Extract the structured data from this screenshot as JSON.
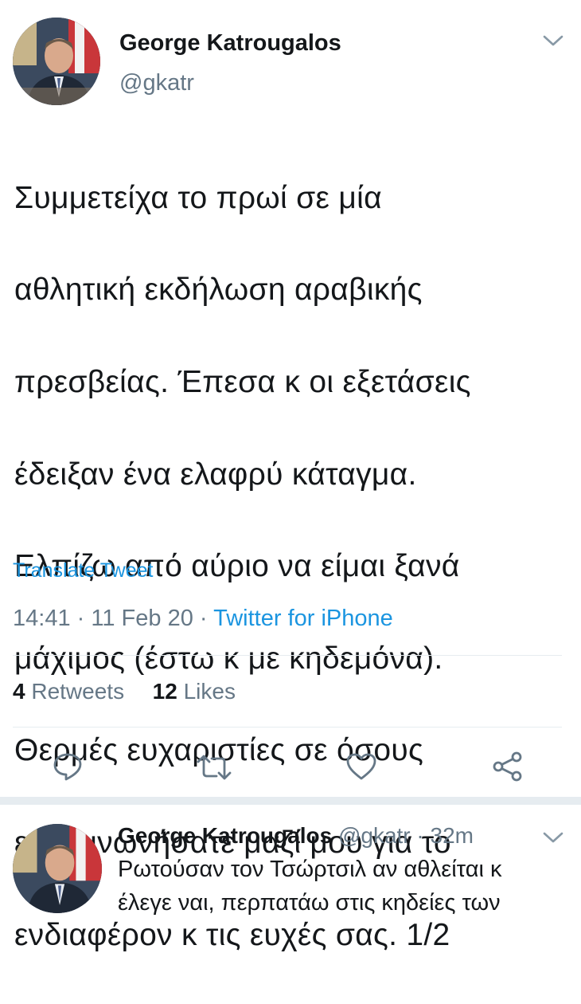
{
  "main_tweet": {
    "author_name": "George Katrougalos",
    "author_handle": "@gkatr",
    "text_lines": [
      "Συμμετείχα το πρωί σε μία",
      "αθλητική εκδήλωση αραβικής",
      "πρεσβείας. Έπεσα κ οι εξετάσεις",
      "έδειξαν ένα ελαφρύ κάταγμα.",
      "Ελπίζω από αύριο να είμαι ξανά",
      "μάχιμος (έστω κ με κηδεμόνα).",
      "Θερμές ευχαριστίες σε όσους",
      "επικοινωνήσατε μαζί μου για το",
      "ενδιαφέρον κ τις ευχές σας. 1/2"
    ],
    "translate_label": "Translate Tweet",
    "time": "14:41",
    "date": "11 Feb 20",
    "separator": "·",
    "source": "Twitter for iPhone",
    "retweets_count": "4",
    "retweets_label": "Retweets",
    "likes_count": "12",
    "likes_label": "Likes"
  },
  "actions": {
    "reply_icon": "reply-icon",
    "retweet_icon": "retweet-icon",
    "like_icon": "like-icon",
    "share_icon": "share-icon"
  },
  "reply_tweet": {
    "author_name": "George Katrougalos",
    "author_handle": "@gkatr",
    "separator": "·",
    "time_ago": "32m",
    "text_line_1": "Ρωτούσαν τον Τσώρτσιλ αν αθλείται κ",
    "text_line_2": "έλεγε ναι, περπατάω στις κηδείες των"
  },
  "colors": {
    "text": "#14171a",
    "muted": "#657786",
    "link": "#1b95e0",
    "divider": "#e6ecf0"
  }
}
